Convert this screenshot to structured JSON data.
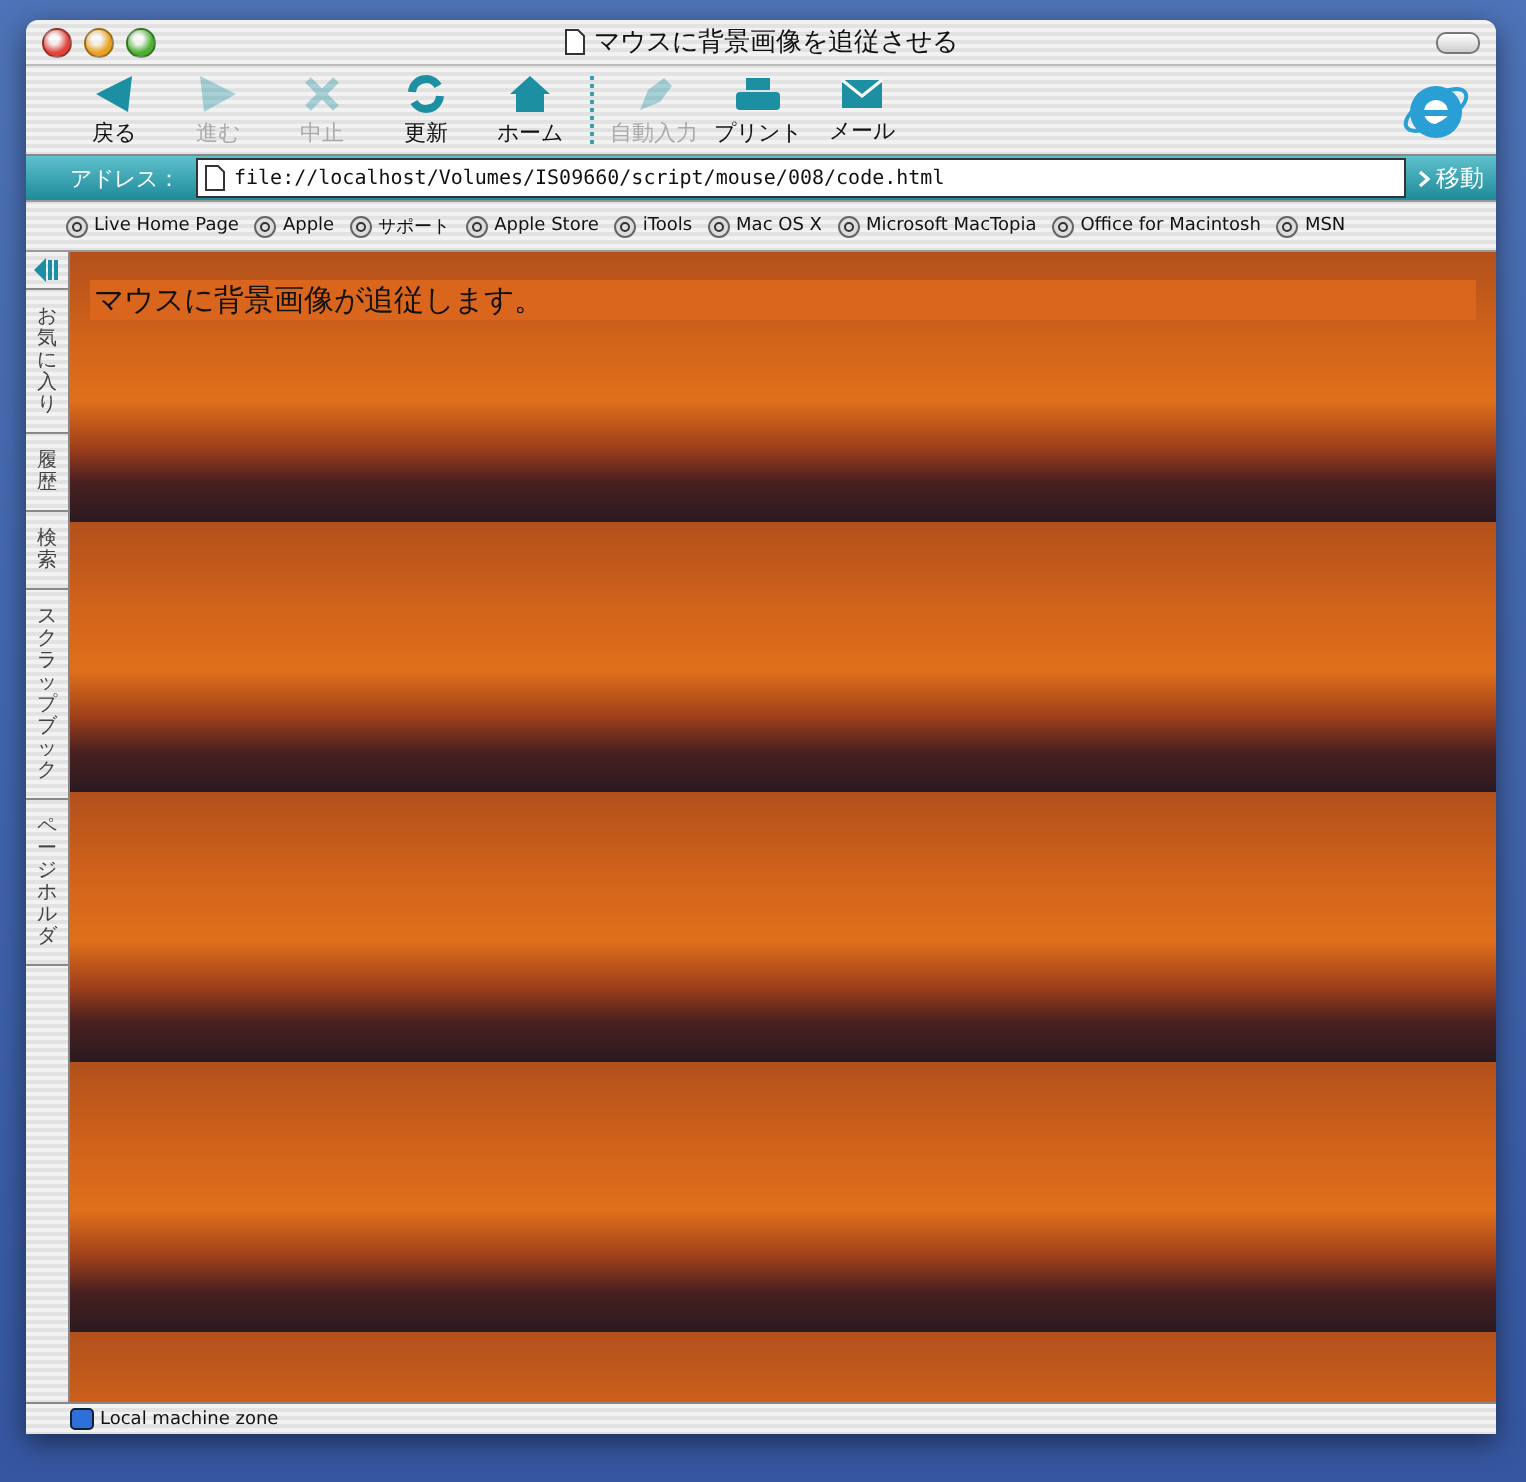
{
  "window": {
    "title": "マウスに背景画像を追従させる"
  },
  "toolbar": {
    "buttons": [
      {
        "kind": "back",
        "label": "戻る",
        "disabled": false
      },
      {
        "kind": "forward",
        "label": "進む",
        "disabled": true
      },
      {
        "kind": "stop",
        "label": "中止",
        "disabled": true
      },
      {
        "kind": "refresh",
        "label": "更新",
        "disabled": false
      },
      {
        "kind": "home",
        "label": "ホーム",
        "disabled": false
      },
      {
        "kind": "autofill",
        "label": "自動入力",
        "disabled": true
      },
      {
        "kind": "print",
        "label": "プリント",
        "disabled": false
      },
      {
        "kind": "mail",
        "label": "メール",
        "disabled": false
      }
    ]
  },
  "address_bar": {
    "label": "アドレス：",
    "value": "file://localhost/Volumes/IS09660/script/mouse/008/code.html",
    "go_button": "移動"
  },
  "favorites": [
    "Live Home Page",
    "Apple",
    "サポート",
    "Apple Store",
    "iTools",
    "Mac OS X",
    "Microsoft MacTopia",
    "Office for Macintosh",
    "MSN"
  ],
  "sidebar": {
    "tabs": [
      "お気に入り",
      "履歴",
      "検索",
      "スクラップブック",
      "ページホルダ"
    ]
  },
  "page": {
    "message": "マウスに背景画像が追従します。"
  },
  "status_bar": {
    "zone": "Local machine zone"
  }
}
